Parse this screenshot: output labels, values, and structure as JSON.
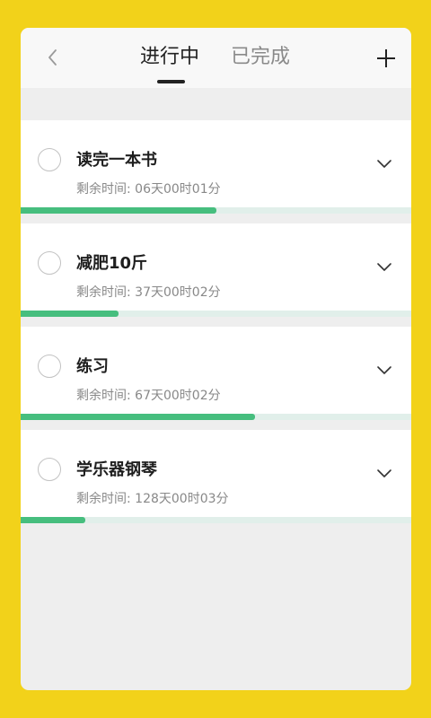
{
  "header": {
    "back_icon": "chevron-left-icon",
    "add_icon": "plus-icon",
    "tabs": [
      {
        "label": "进行中",
        "active": true
      },
      {
        "label": "已完成",
        "active": false
      }
    ]
  },
  "colors": {
    "background": "#f2d21a",
    "progress_fill": "#46be7e",
    "progress_track": "#e1efea"
  },
  "tasks": [
    {
      "title": "读完一本书",
      "remaining": "剩余时间: 06天00时01分",
      "progress_fraction": 0.5
    },
    {
      "title": "减肥10斤",
      "remaining": "剩余时间: 37天00时02分",
      "progress_fraction": 0.25
    },
    {
      "title": "练习",
      "remaining": "剩余时间: 67天00时02分",
      "progress_fraction": 0.6
    },
    {
      "title": "学乐器钢琴",
      "remaining": "剩余时间: 128天00时03分",
      "progress_fraction": 0.165
    }
  ]
}
